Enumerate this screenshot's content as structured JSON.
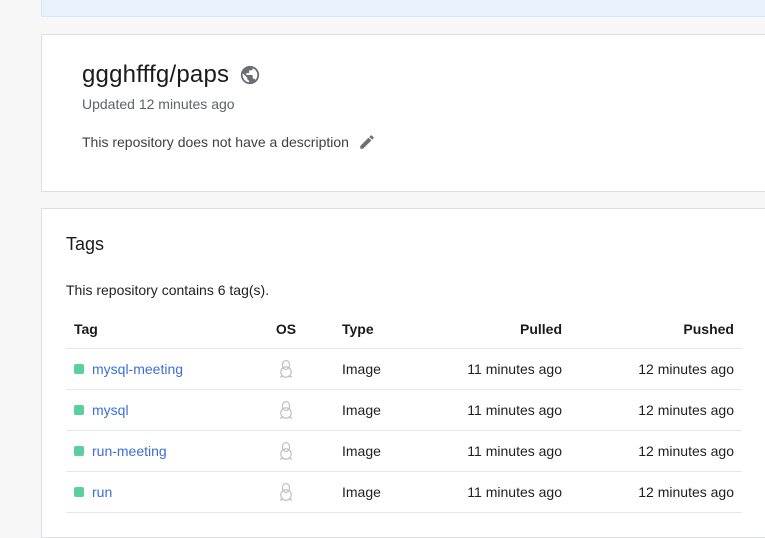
{
  "repository": {
    "title": "ggghfffg/paps",
    "updated": "Updated 12 minutes ago",
    "description": "This repository does not have a description"
  },
  "tags": {
    "heading": "Tags",
    "count_text": "This repository contains 6 tag(s).",
    "columns": {
      "tag": "Tag",
      "os": "OS",
      "type": "Type",
      "pulled": "Pulled",
      "pushed": "Pushed"
    },
    "rows": [
      {
        "name": "mysql-meeting",
        "os": "linux-icon",
        "type": "Image",
        "pulled": "11 minutes ago",
        "pushed": "12 minutes ago"
      },
      {
        "name": "mysql",
        "os": "linux-icon",
        "type": "Image",
        "pulled": "11 minutes ago",
        "pushed": "12 minutes ago"
      },
      {
        "name": "run-meeting",
        "os": "linux-icon",
        "type": "Image",
        "pulled": "11 minutes ago",
        "pushed": "12 minutes ago"
      },
      {
        "name": "run",
        "os": "linux-icon",
        "type": "Image",
        "pulled": "11 minutes ago",
        "pushed": "12 minutes ago"
      }
    ]
  },
  "colors": {
    "link": "#3c6fd6",
    "status_dot": "#5ccf9e",
    "banner": "#e9f2fc"
  }
}
